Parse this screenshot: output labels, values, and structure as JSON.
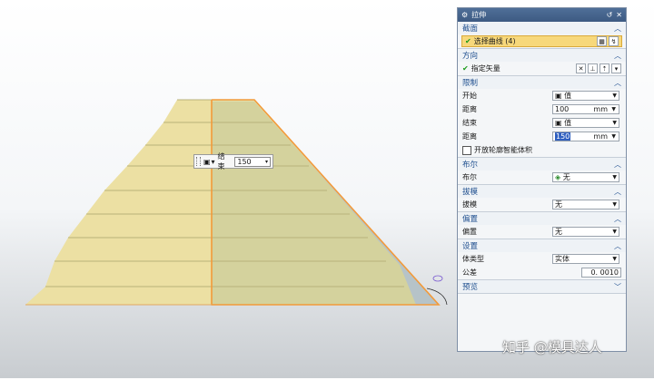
{
  "dialog": {
    "title": "拉伸",
    "sections": {
      "section": {
        "title": "截面",
        "select_curve": "选择曲线 (4)"
      },
      "direction": {
        "title": "方向",
        "specify_vector": "指定矢量"
      },
      "limits": {
        "title": "限制",
        "start_label": "开始",
        "start_value": "值",
        "distance1_label": "距离",
        "distance1_value": "100",
        "distance1_unit": "mm",
        "end_label": "结束",
        "end_value": "值",
        "distance2_label": "距离",
        "distance2_value": "150",
        "distance2_unit": "mm",
        "open_profile": "开放轮廓智能体积"
      },
      "boolean": {
        "title": "布尔",
        "label": "布尔",
        "value": "无"
      },
      "draft": {
        "title": "拔模",
        "label": "拔模",
        "value": "无"
      },
      "offset": {
        "title": "偏置",
        "label": "偏置",
        "value": "无"
      },
      "settings": {
        "title": "设置",
        "body_type_label": "体类型",
        "body_type_value": "实体",
        "tolerance_label": "公差",
        "tolerance_value": "0. 0010"
      },
      "preview": {
        "title": "预览"
      }
    }
  },
  "floating_toolbar": {
    "label": "结束",
    "value": "150"
  },
  "watermark": "知乎 @模具达人",
  "colors": {
    "title_bar": "#3d5a82",
    "section_header": "#1f4f8f",
    "highlight": "#f7d87b",
    "face_yellow": "#e8dc9e",
    "face_gray": "#b7c3c7",
    "edge_orange": "#f29a3a"
  }
}
